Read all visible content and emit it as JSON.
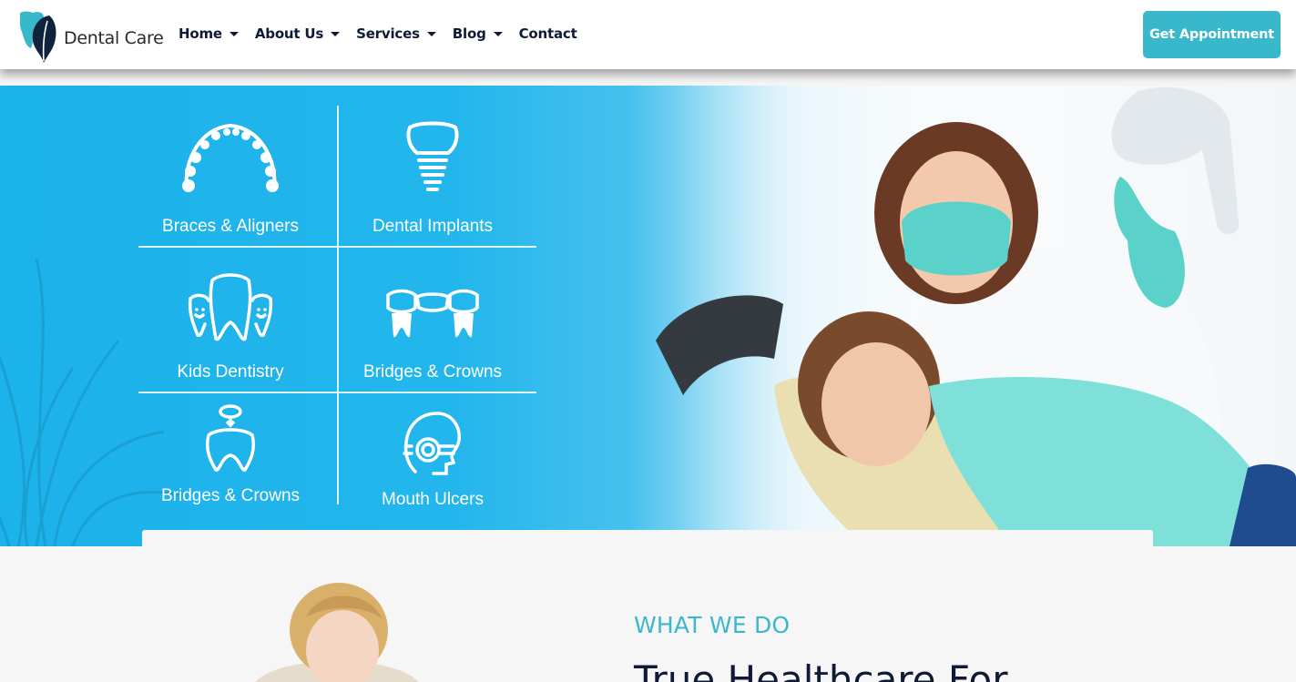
{
  "brand": {
    "name": "Dental Care",
    "logo_icon": "tooth-leaf-logo"
  },
  "nav": {
    "items": [
      {
        "label": "Home",
        "dropdown": true
      },
      {
        "label": "About Us",
        "dropdown": true
      },
      {
        "label": "Services",
        "dropdown": true
      },
      {
        "label": "Blog",
        "dropdown": true
      },
      {
        "label": "Contact",
        "dropdown": false
      }
    ],
    "cta_label": "Get Appointment"
  },
  "hero": {
    "services": [
      {
        "label": "Braces & Aligners",
        "icon": "braces-icon"
      },
      {
        "label": "Dental Implants",
        "icon": "implant-icon"
      },
      {
        "label": "Kids Dentistry",
        "icon": "kids-teeth-icon"
      },
      {
        "label": "Bridges & Crowns",
        "icon": "bridge-icon"
      },
      {
        "label": "Bridges & Crowns",
        "icon": "crown-icon"
      },
      {
        "label": "Mouth Ulcers",
        "icon": "mouth-ulcer-icon"
      }
    ]
  },
  "about": {
    "eyebrow": "WHAT WE DO",
    "headline": "True Healthcare For"
  },
  "colors": {
    "accent": "#3ab8cb",
    "navy": "#0f1b36",
    "hero_blue": "#1cb2ea"
  }
}
